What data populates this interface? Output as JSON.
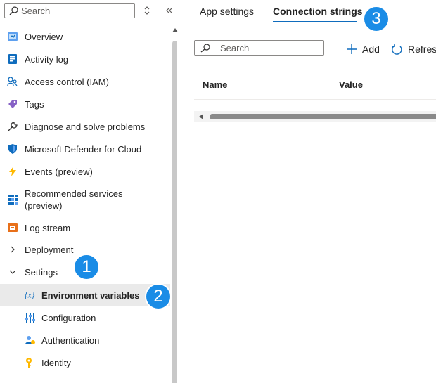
{
  "sidebar": {
    "search_placeholder": "Search",
    "items": [
      {
        "label": "Overview",
        "icon": "overview-icon"
      },
      {
        "label": "Activity log",
        "icon": "activity-log-icon"
      },
      {
        "label": "Access control (IAM)",
        "icon": "iam-icon"
      },
      {
        "label": "Tags",
        "icon": "tag-icon"
      },
      {
        "label": "Diagnose and solve problems",
        "icon": "wrench-icon"
      },
      {
        "label": "Microsoft Defender for Cloud",
        "icon": "shield-icon"
      },
      {
        "label": "Events (preview)",
        "icon": "lightning-icon"
      },
      {
        "label": "Recommended services\n(preview)",
        "icon": "grid-icon"
      },
      {
        "label": "Log stream",
        "icon": "log-stream-icon"
      },
      {
        "label": "Deployment",
        "icon": "chevron-right-icon"
      },
      {
        "label": "Settings",
        "icon": "chevron-down-icon"
      },
      {
        "label": "Environment variables",
        "icon": "variables-icon",
        "selected": true
      },
      {
        "label": "Configuration",
        "icon": "configuration-icon"
      },
      {
        "label": "Authentication",
        "icon": "authentication-icon"
      },
      {
        "label": "Identity",
        "icon": "identity-key-icon"
      }
    ]
  },
  "tabs": [
    {
      "label": "App settings",
      "active": false
    },
    {
      "label": "Connection strings",
      "active": true
    }
  ],
  "toolbar": {
    "search_placeholder": "Search",
    "add_label": "Add",
    "refresh_label": "Refresh"
  },
  "table": {
    "columns": [
      "Name",
      "Value"
    ]
  },
  "callouts": [
    "1",
    "2",
    "3"
  ],
  "colors": {
    "accent": "#0f6cbd",
    "callout": "#1a8ce6",
    "selected_row": "#eaeaea"
  }
}
